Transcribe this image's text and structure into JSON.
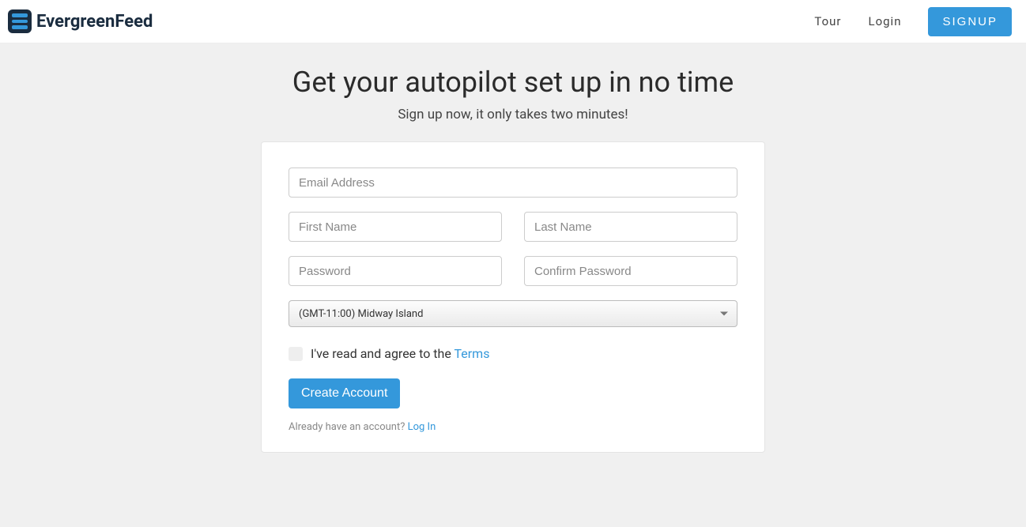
{
  "header": {
    "brand": "EvergreenFeed",
    "nav": {
      "tour": "Tour",
      "login": "Login",
      "signup": "SIGNUP"
    }
  },
  "main": {
    "heading": "Get your autopilot set up in no time",
    "subheading": "Sign up now, it only takes two minutes!"
  },
  "form": {
    "email_placeholder": "Email Address",
    "first_name_placeholder": "First Name",
    "last_name_placeholder": "Last Name",
    "password_placeholder": "Password",
    "confirm_password_placeholder": "Confirm Password",
    "timezone_selected": "(GMT-11:00) Midway Island",
    "agree_prefix": "I've read and agree to the ",
    "terms_label": "Terms",
    "create_button": "Create Account",
    "already_prefix": "Already have an account? ",
    "login_link": "Log In"
  }
}
